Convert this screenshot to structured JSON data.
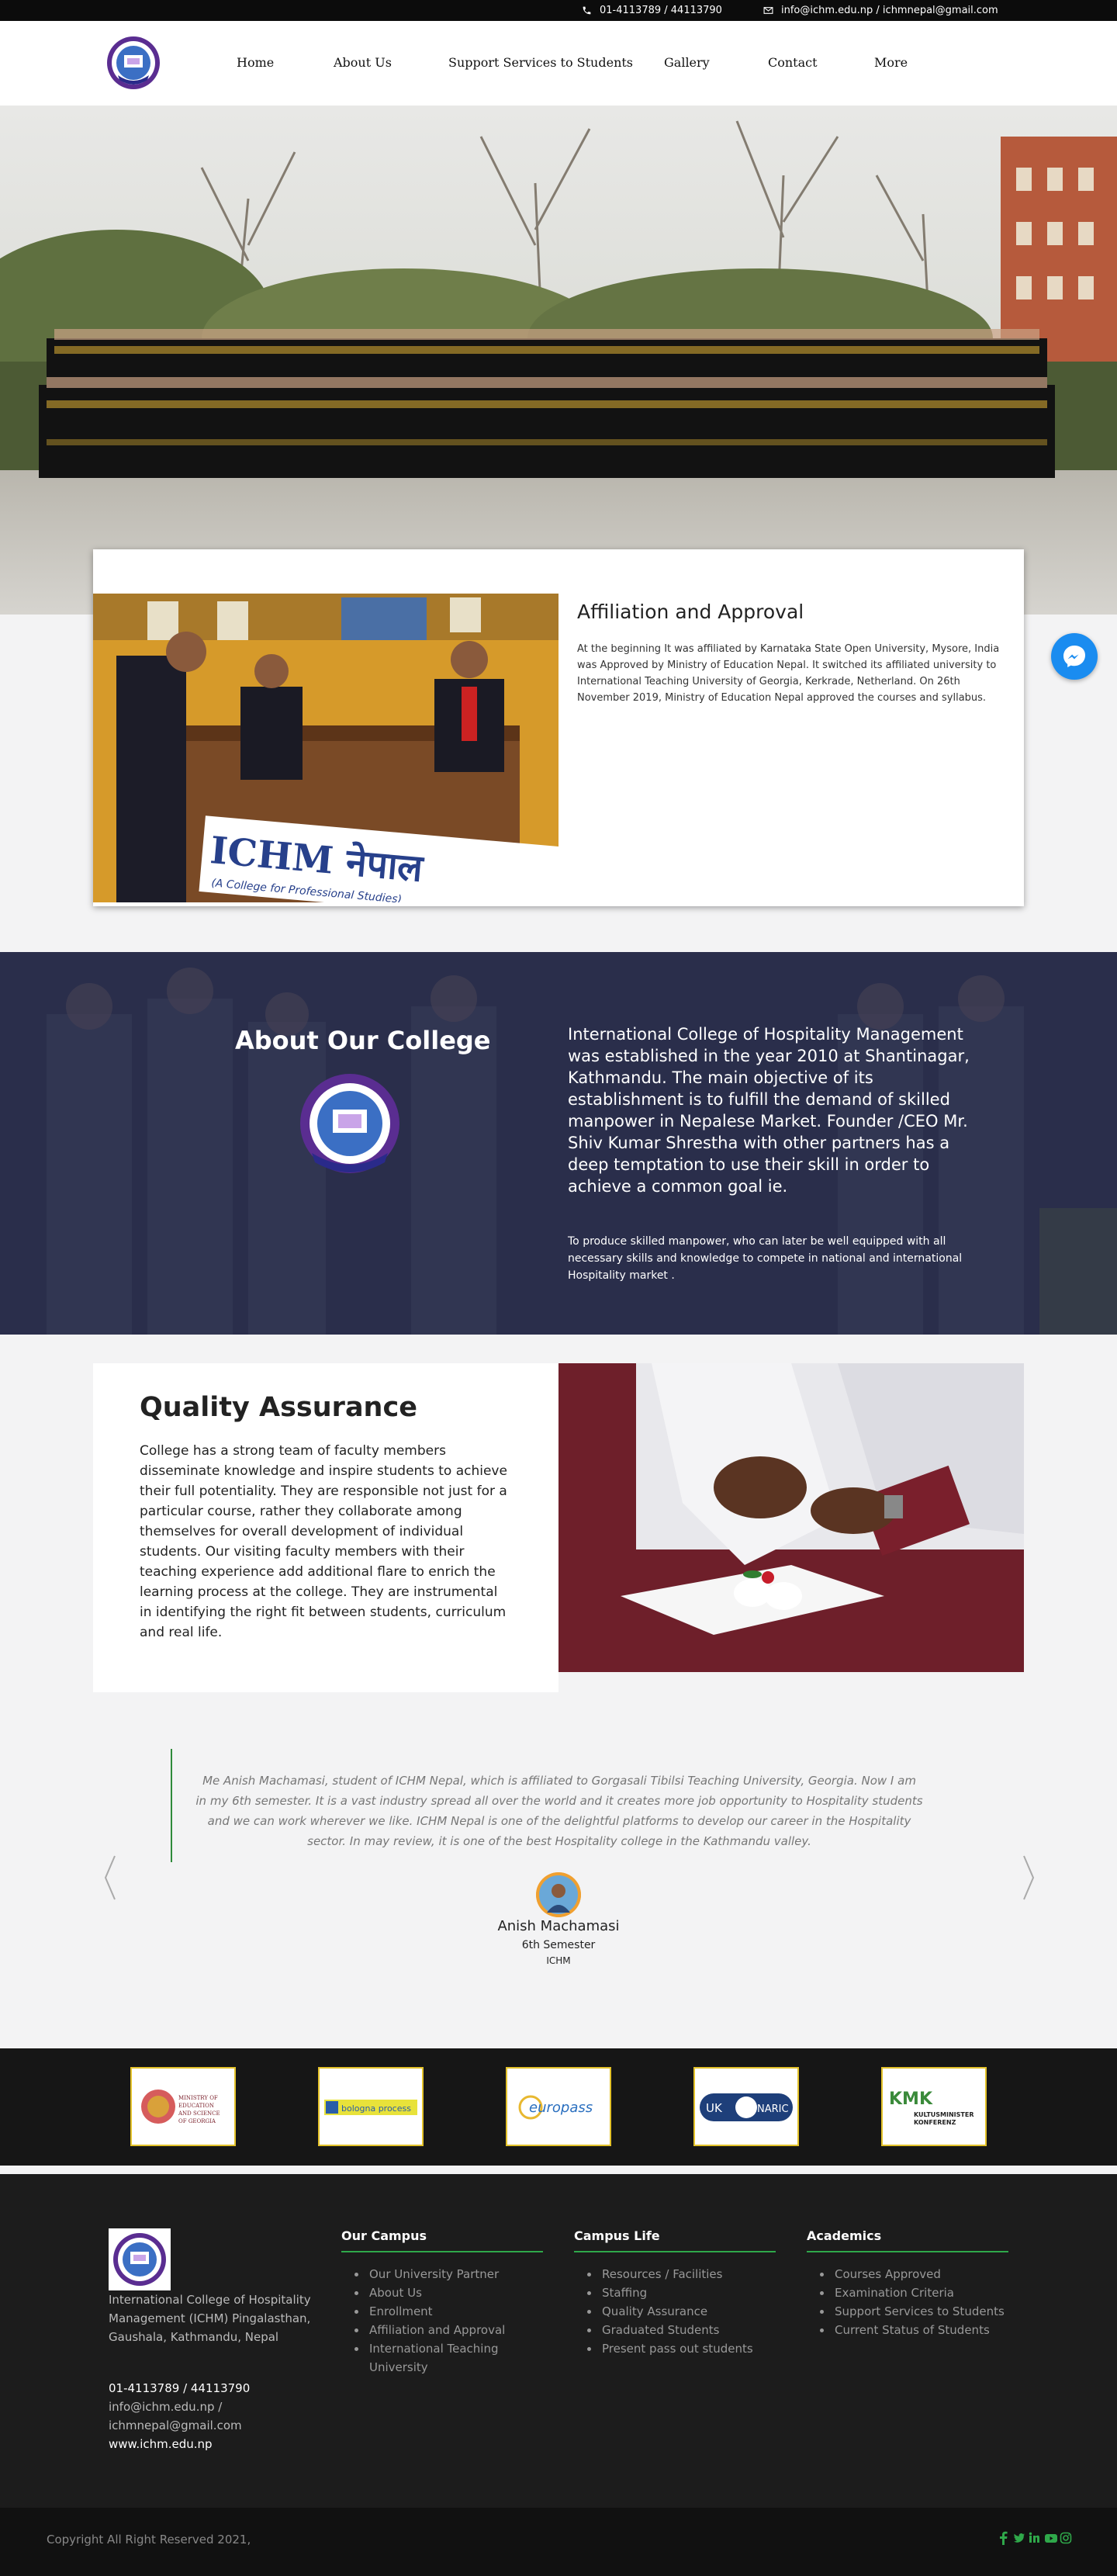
{
  "topbar": {
    "phone": "01-4113789 / 44113790",
    "email": "info@ichm.edu.np / ichmnepal@gmail.com"
  },
  "nav": {
    "items": [
      "Home",
      "About Us",
      "Support Services to Students",
      "Gallery",
      "Contact",
      "More"
    ]
  },
  "affiliation": {
    "title": "Affiliation and Approval",
    "text": "At the beginning It was affiliated by Karnataka State Open University, Mysore, India was Approved by Ministry of Education Nepal. It switched its affiliated university to International Teaching University of Georgia, Kerkrade, Netherland. On 26th November 2019, Ministry of Education Nepal approved the courses and syllabus.",
    "sign_text": "ICHM नेपाल",
    "sign_sub": "(A College for Professional Studies)"
  },
  "about": {
    "title": "About Our College",
    "text": "International College of Hospitality Management was established in the year 2010 at Shantinagar, Kathmandu. The main objective of its establishment is to fulfill the demand of skilled manpower in Nepalese Market. Founder /CEO Mr. Shiv Kumar Shrestha with other partners has a deep temptation to use their skill in order to achieve a common goal ie.",
    "small_text": "To produce skilled manpower, who can later be well equipped with all necessary skills and knowledge to compete in national and international Hospitality market ."
  },
  "quality": {
    "title": "Quality Assurance",
    "text": "College has a strong team of faculty members disseminate knowledge and inspire students to achieve their full potentiality. They are responsible not just for a particular course, rather they collaborate among themselves for overall development of individual students. Our visiting faculty members with their teaching experience add additional flare to enrich the learning process at the college. They are instrumental in identifying the right fit between students, curriculum and real life."
  },
  "testimonial": {
    "quote": "Me Anish Machamasi, student of ICHM Nepal, which is affiliated to Gorgasali Tibilsi Teaching University, Georgia. Now I am in my 6th semester. It is a vast industry spread all over the world and it creates more job opportunity to Hospitality students and we can work wherever we like. ICHM Nepal is one of the delightful platforms to develop our career in the Hospitality sector. In may review, it is one of the best Hospitality college in the Kathmandu valley.",
    "name": "Anish Machamasi",
    "semester": "6th Semester",
    "org": "ICHM"
  },
  "partners": [
    {
      "name": "ministry-georgia",
      "label": "MINISTRY OF EDUCATION AND SCIENCE OF GEORGIA"
    },
    {
      "name": "bologna-process",
      "label": "bologna process"
    },
    {
      "name": "europass",
      "label": "europass"
    },
    {
      "name": "uk-naric",
      "label": "UK NARIC"
    },
    {
      "name": "kmk",
      "label": "KULTUSMINISTER KONFERENZ"
    }
  ],
  "footer": {
    "address": "International College of Hospitality Management (ICHM) Pingalasthan, Gaushala, Kathmandu, Nepal",
    "phone": "01-4113789 / 44113790",
    "email": "info@ichm.edu.np / ichmnepal@gmail.com",
    "website": "www.ichm.edu.np",
    "columns": [
      {
        "title": "Our Campus",
        "items": [
          "Our University Partner",
          "About Us",
          "Enrollment",
          "Affiliation and Approval",
          "International Teaching University"
        ]
      },
      {
        "title": "Campus Life",
        "items": [
          "Resources / Facilities",
          "Staffing",
          "Quality Assurance",
          "Graduated Students",
          "Present pass out students"
        ]
      },
      {
        "title": "Academics",
        "items": [
          "Courses Approved",
          "Examination Criteria",
          "Support Services to Students",
          "Current Status of Students"
        ]
      }
    ]
  },
  "copyright": "Copyright All Right Reserved 2021,",
  "colors": {
    "accent": "#2fa84a",
    "messenger": "#1a8cf0",
    "partner_border": "#e3c22a"
  }
}
